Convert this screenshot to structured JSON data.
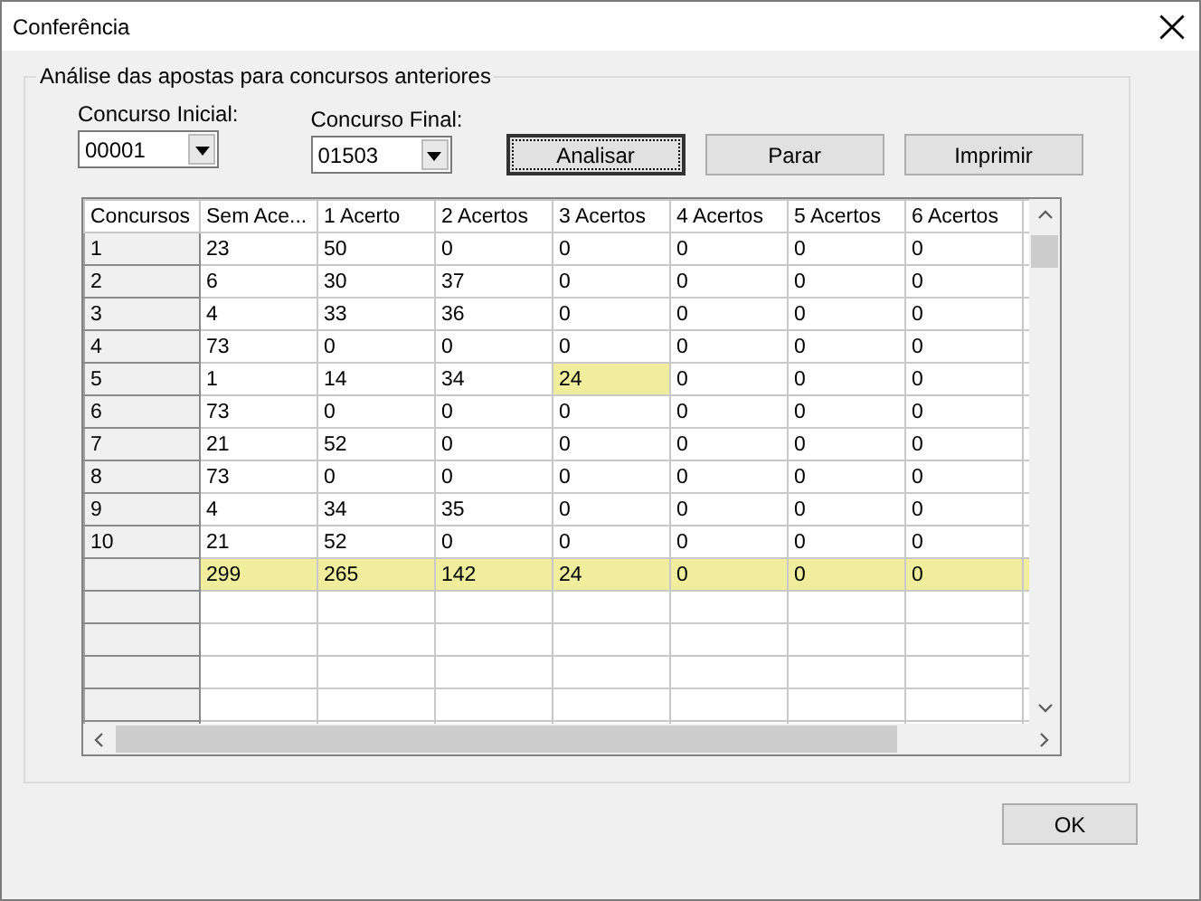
{
  "window": {
    "title": "Conferência"
  },
  "group": {
    "title": "Análise das apostas para concursos anteriores"
  },
  "fields": [
    {
      "label": "Concurso Inicial:",
      "value": "00001"
    },
    {
      "label": "Concurso Final:",
      "value": "01503"
    }
  ],
  "buttons": [
    {
      "label": "Analisar",
      "focused": true
    },
    {
      "label": "Parar",
      "focused": false
    },
    {
      "label": "Imprimir",
      "focused": false
    }
  ],
  "table": {
    "columns": [
      "Concursos",
      "Sem Ace...",
      "1 Acerto",
      "2 Acertos",
      "3 Acertos",
      "4 Acertos",
      "5 Acertos",
      "6 Acertos"
    ],
    "rows": [
      {
        "cells": [
          {
            "kind": "header",
            "text": "1",
            "highlighted": false
          },
          {
            "kind": "data",
            "text": "23",
            "highlighted": false
          },
          {
            "kind": "data",
            "text": "50",
            "highlighted": false
          },
          {
            "kind": "data",
            "text": "0",
            "highlighted": false
          },
          {
            "kind": "data",
            "text": "0",
            "highlighted": false
          },
          {
            "kind": "data",
            "text": "0",
            "highlighted": false
          },
          {
            "kind": "data",
            "text": "0",
            "highlighted": false
          },
          {
            "kind": "data",
            "text": "0",
            "highlighted": false
          }
        ]
      },
      {
        "cells": [
          {
            "kind": "header",
            "text": "2",
            "highlighted": false
          },
          {
            "kind": "data",
            "text": "6",
            "highlighted": false
          },
          {
            "kind": "data",
            "text": "30",
            "highlighted": false
          },
          {
            "kind": "data",
            "text": "37",
            "highlighted": false
          },
          {
            "kind": "data",
            "text": "0",
            "highlighted": false
          },
          {
            "kind": "data",
            "text": "0",
            "highlighted": false
          },
          {
            "kind": "data",
            "text": "0",
            "highlighted": false
          },
          {
            "kind": "data",
            "text": "0",
            "highlighted": false
          }
        ]
      },
      {
        "cells": [
          {
            "kind": "header",
            "text": "3",
            "highlighted": false
          },
          {
            "kind": "data",
            "text": "4",
            "highlighted": false
          },
          {
            "kind": "data",
            "text": "33",
            "highlighted": false
          },
          {
            "kind": "data",
            "text": "36",
            "highlighted": false
          },
          {
            "kind": "data",
            "text": "0",
            "highlighted": false
          },
          {
            "kind": "data",
            "text": "0",
            "highlighted": false
          },
          {
            "kind": "data",
            "text": "0",
            "highlighted": false
          },
          {
            "kind": "data",
            "text": "0",
            "highlighted": false
          }
        ]
      },
      {
        "cells": [
          {
            "kind": "header",
            "text": "4",
            "highlighted": false
          },
          {
            "kind": "data",
            "text": "73",
            "highlighted": false
          },
          {
            "kind": "data",
            "text": "0",
            "highlighted": false
          },
          {
            "kind": "data",
            "text": "0",
            "highlighted": false
          },
          {
            "kind": "data",
            "text": "0",
            "highlighted": false
          },
          {
            "kind": "data",
            "text": "0",
            "highlighted": false
          },
          {
            "kind": "data",
            "text": "0",
            "highlighted": false
          },
          {
            "kind": "data",
            "text": "0",
            "highlighted": false
          }
        ]
      },
      {
        "cells": [
          {
            "kind": "header",
            "text": "5",
            "highlighted": false
          },
          {
            "kind": "data",
            "text": "1",
            "highlighted": false
          },
          {
            "kind": "data",
            "text": "14",
            "highlighted": false
          },
          {
            "kind": "data",
            "text": "34",
            "highlighted": false
          },
          {
            "kind": "data",
            "text": "24",
            "highlighted": true
          },
          {
            "kind": "data",
            "text": "0",
            "highlighted": false
          },
          {
            "kind": "data",
            "text": "0",
            "highlighted": false
          },
          {
            "kind": "data",
            "text": "0",
            "highlighted": false
          }
        ]
      },
      {
        "cells": [
          {
            "kind": "header",
            "text": "6",
            "highlighted": false
          },
          {
            "kind": "data",
            "text": "73",
            "highlighted": false
          },
          {
            "kind": "data",
            "text": "0",
            "highlighted": false
          },
          {
            "kind": "data",
            "text": "0",
            "highlighted": false
          },
          {
            "kind": "data",
            "text": "0",
            "highlighted": false
          },
          {
            "kind": "data",
            "text": "0",
            "highlighted": false
          },
          {
            "kind": "data",
            "text": "0",
            "highlighted": false
          },
          {
            "kind": "data",
            "text": "0",
            "highlighted": false
          }
        ]
      },
      {
        "cells": [
          {
            "kind": "header",
            "text": "7",
            "highlighted": false
          },
          {
            "kind": "data",
            "text": "21",
            "highlighted": false
          },
          {
            "kind": "data",
            "text": "52",
            "highlighted": false
          },
          {
            "kind": "data",
            "text": "0",
            "highlighted": false
          },
          {
            "kind": "data",
            "text": "0",
            "highlighted": false
          },
          {
            "kind": "data",
            "text": "0",
            "highlighted": false
          },
          {
            "kind": "data",
            "text": "0",
            "highlighted": false
          },
          {
            "kind": "data",
            "text": "0",
            "highlighted": false
          }
        ]
      },
      {
        "cells": [
          {
            "kind": "header",
            "text": "8",
            "highlighted": false
          },
          {
            "kind": "data",
            "text": "73",
            "highlighted": false
          },
          {
            "kind": "data",
            "text": "0",
            "highlighted": false
          },
          {
            "kind": "data",
            "text": "0",
            "highlighted": false
          },
          {
            "kind": "data",
            "text": "0",
            "highlighted": false
          },
          {
            "kind": "data",
            "text": "0",
            "highlighted": false
          },
          {
            "kind": "data",
            "text": "0",
            "highlighted": false
          },
          {
            "kind": "data",
            "text": "0",
            "highlighted": false
          }
        ]
      },
      {
        "cells": [
          {
            "kind": "header",
            "text": "9",
            "highlighted": false
          },
          {
            "kind": "data",
            "text": "4",
            "highlighted": false
          },
          {
            "kind": "data",
            "text": "34",
            "highlighted": false
          },
          {
            "kind": "data",
            "text": "35",
            "highlighted": false
          },
          {
            "kind": "data",
            "text": "0",
            "highlighted": false
          },
          {
            "kind": "data",
            "text": "0",
            "highlighted": false
          },
          {
            "kind": "data",
            "text": "0",
            "highlighted": false
          },
          {
            "kind": "data",
            "text": "0",
            "highlighted": false
          }
        ]
      },
      {
        "cells": [
          {
            "kind": "header",
            "text": "10",
            "highlighted": false
          },
          {
            "kind": "data",
            "text": "21",
            "highlighted": false
          },
          {
            "kind": "data",
            "text": "52",
            "highlighted": false
          },
          {
            "kind": "data",
            "text": "0",
            "highlighted": false
          },
          {
            "kind": "data",
            "text": "0",
            "highlighted": false
          },
          {
            "kind": "data",
            "text": "0",
            "highlighted": false
          },
          {
            "kind": "data",
            "text": "0",
            "highlighted": false
          },
          {
            "kind": "data",
            "text": "0",
            "highlighted": false
          }
        ]
      },
      {
        "cells": [
          {
            "kind": "header",
            "text": "",
            "highlighted": false
          },
          {
            "kind": "data",
            "text": "299",
            "highlighted": true
          },
          {
            "kind": "data",
            "text": "265",
            "highlighted": true
          },
          {
            "kind": "data",
            "text": "142",
            "highlighted": true
          },
          {
            "kind": "data",
            "text": "24",
            "highlighted": true
          },
          {
            "kind": "data",
            "text": "0",
            "highlighted": true
          },
          {
            "kind": "data",
            "text": "0",
            "highlighted": true
          },
          {
            "kind": "data",
            "text": "0",
            "highlighted": true
          }
        ]
      }
    ]
  },
  "footer_buttons": [
    {
      "label": "OK",
      "focused": false
    }
  ]
}
